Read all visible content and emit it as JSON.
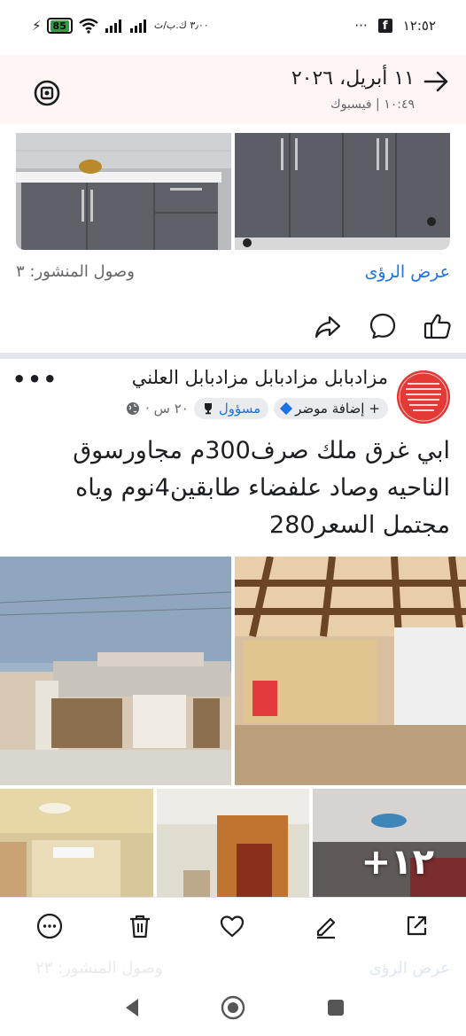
{
  "status_bar": {
    "battery": "85",
    "speed": "٣٫٠٠ ك.ب/ث",
    "clock": "١٢:٥٢",
    "more": "···"
  },
  "header": {
    "title": "١١ أبريل، ٢٠٢٦",
    "subtitle": "١٠:٤٩ | فيسبوك"
  },
  "post1": {
    "view_insights": "عرض الرؤى",
    "reach": "وصول المنشور: ٣"
  },
  "post2": {
    "group_name": "مزادبابل مزادبابل مزادبابل العلني",
    "more": "•••",
    "add_topic": "إضافة موضر",
    "badge": "مسؤول",
    "time": "٢٠ س ·",
    "text": "ابي غرق ملك صرف300م مجاورسوق الناحيه وصاد علفضاء طابقين4نوم وياه مجتمل السعر280",
    "more_photos": "+١٢"
  },
  "ghost_row": {
    "reach": "وصول المنشور: ٢٣",
    "view_insights": "عرض الرؤى"
  },
  "icons": {
    "share": "share-icon",
    "comment": "comment-icon",
    "like": "like-icon"
  },
  "colors": {
    "accent": "#1b74e4",
    "header_bg": "#fff5f5",
    "divider": "#e4e6eb"
  }
}
